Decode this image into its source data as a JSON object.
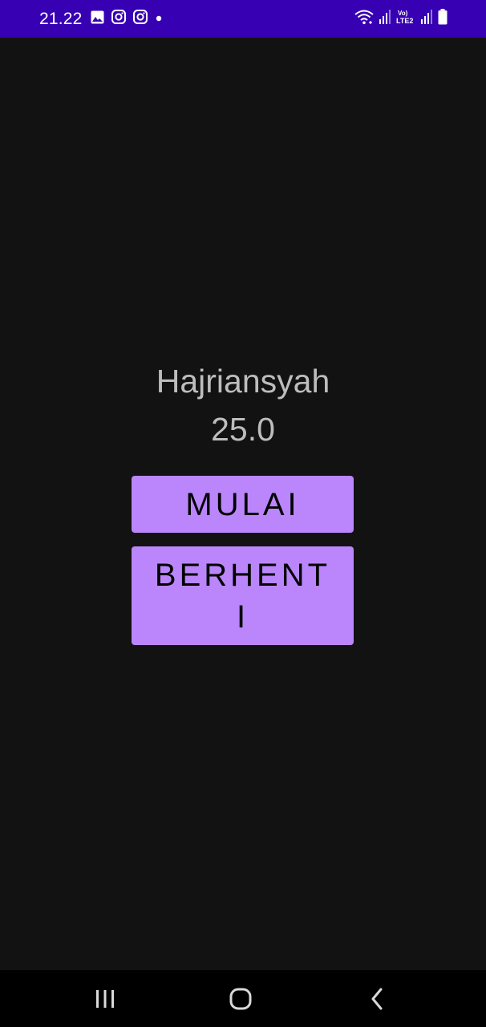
{
  "status_bar": {
    "time": "21.22",
    "bg_color": "#3700b3",
    "left_icons": [
      "image-icon",
      "instagram-icon",
      "instagram-icon",
      "dot-icon"
    ],
    "right_icons": [
      "wifi-icon",
      "signal-icon",
      "volte-lte2-icon",
      "signal-icon",
      "battery-icon"
    ],
    "volte_label": "Vo)",
    "lte_label": "LTE2"
  },
  "main": {
    "name": "Hajriansyah",
    "value": "25.0",
    "start_button_label": "MULAI",
    "stop_button_label": "BERHENTI",
    "button_color": "#bb86fc",
    "background": "#121212"
  },
  "nav_bar": {
    "items": [
      "recent-apps-icon",
      "home-icon",
      "back-icon"
    ]
  }
}
